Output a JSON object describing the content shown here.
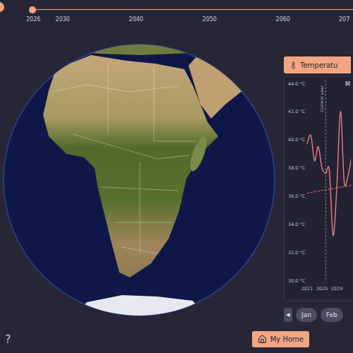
{
  "timeline": {
    "level": 0,
    "ticks": [
      {
        "label": "2026",
        "year": 2026
      },
      {
        "label": "2030",
        "year": 2030
      },
      {
        "label": "2040",
        "year": 2040
      },
      {
        "label": "2050",
        "year": 2050
      },
      {
        "label": "2060",
        "year": 2060
      },
      {
        "label": "207",
        "year": 2070
      }
    ]
  },
  "panel": {
    "tab": {
      "label": "Temperatu",
      "selected": true
    },
    "chart": {
      "title": "M",
      "y_ticks": [
        "44.0 °C",
        "42.0 °C",
        "40.0 °C",
        "38.0 °C",
        "36.0 °C",
        "34.0 °C",
        "32.0 °C",
        "30.0 °C"
      ],
      "x_ticks": [
        "2021",
        "2025",
        "2029"
      ],
      "marker": {
        "label": "Current year",
        "year": 2026
      },
      "series": [
        {
          "years": [
            2021,
            2022,
            2023,
            2024,
            2025,
            2026,
            2027,
            2028,
            2029,
            2030,
            2031,
            2032,
            2033
          ],
          "values": [
            39.7,
            40.3,
            38.5,
            39.5,
            38.0,
            37.6,
            37.8,
            33.2,
            36.5,
            42.0,
            37.0,
            37.4,
            38.8
          ],
          "dashed": false
        },
        {
          "years": [
            2021,
            2033
          ],
          "values": [
            36.2,
            36.75
          ],
          "dashed": true
        }
      ]
    }
  },
  "months": {
    "prev": "◀",
    "items": [
      {
        "label": "Jan",
        "selected": false
      },
      {
        "label": "Feb",
        "selected": false
      }
    ]
  },
  "help": "?",
  "home_button": {
    "label": "My Home"
  }
}
